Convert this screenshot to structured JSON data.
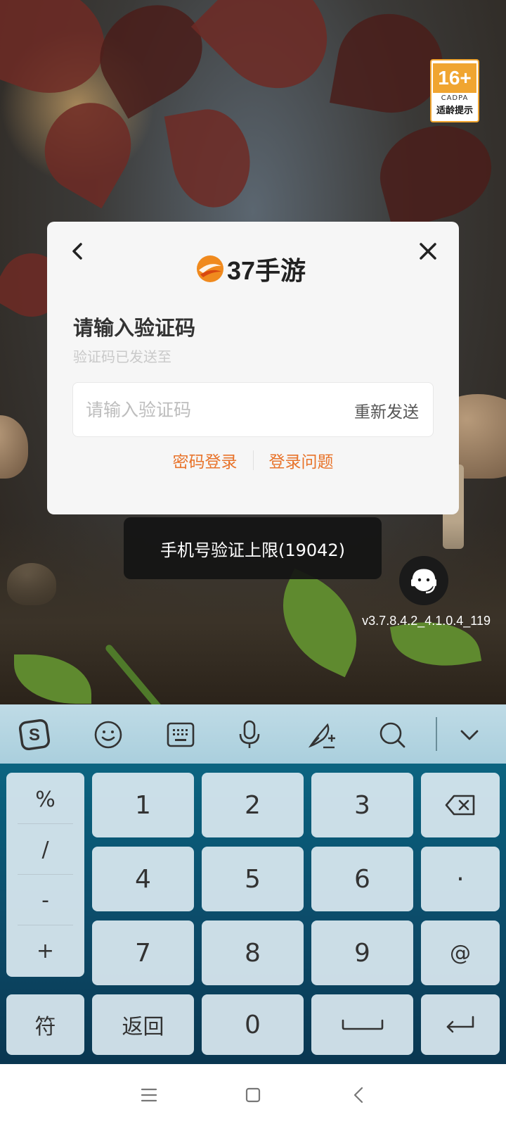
{
  "age_badge": {
    "rating": "16+",
    "org": "CADPA",
    "tip": "适龄提示"
  },
  "dialog": {
    "brand": "37手游",
    "title": "请输入验证码",
    "subtitle": "验证码已发送至",
    "code_input": {
      "placeholder": "请输入验证码",
      "value": ""
    },
    "resend_label": "重新发送",
    "password_login": "密码登录",
    "login_help": "登录问题"
  },
  "toast": "手机号验证上限(19042)",
  "version": "v3.7.8.4.2_4.1.0.4_119",
  "keyboard": {
    "toolbar": [
      "sogou-logo-icon",
      "emoji-icon",
      "keyboard-icon",
      "microphone-icon",
      "handwriting-icon",
      "search-icon",
      "collapse-icon"
    ],
    "side_keys": [
      "%",
      "/",
      "-",
      "+"
    ],
    "rows": [
      [
        "1",
        "2",
        "3"
      ],
      [
        "4",
        "5",
        "6"
      ],
      [
        "7",
        "8",
        "9"
      ]
    ],
    "right_keys": [
      "backspace-icon",
      "·",
      "@"
    ],
    "bottom": {
      "symbols": "符",
      "back": "返回",
      "zero": "0"
    }
  },
  "colors": {
    "accent": "#e8732a",
    "dialog_bg": "#f6f6f6",
    "toast_bg": "#141414"
  }
}
